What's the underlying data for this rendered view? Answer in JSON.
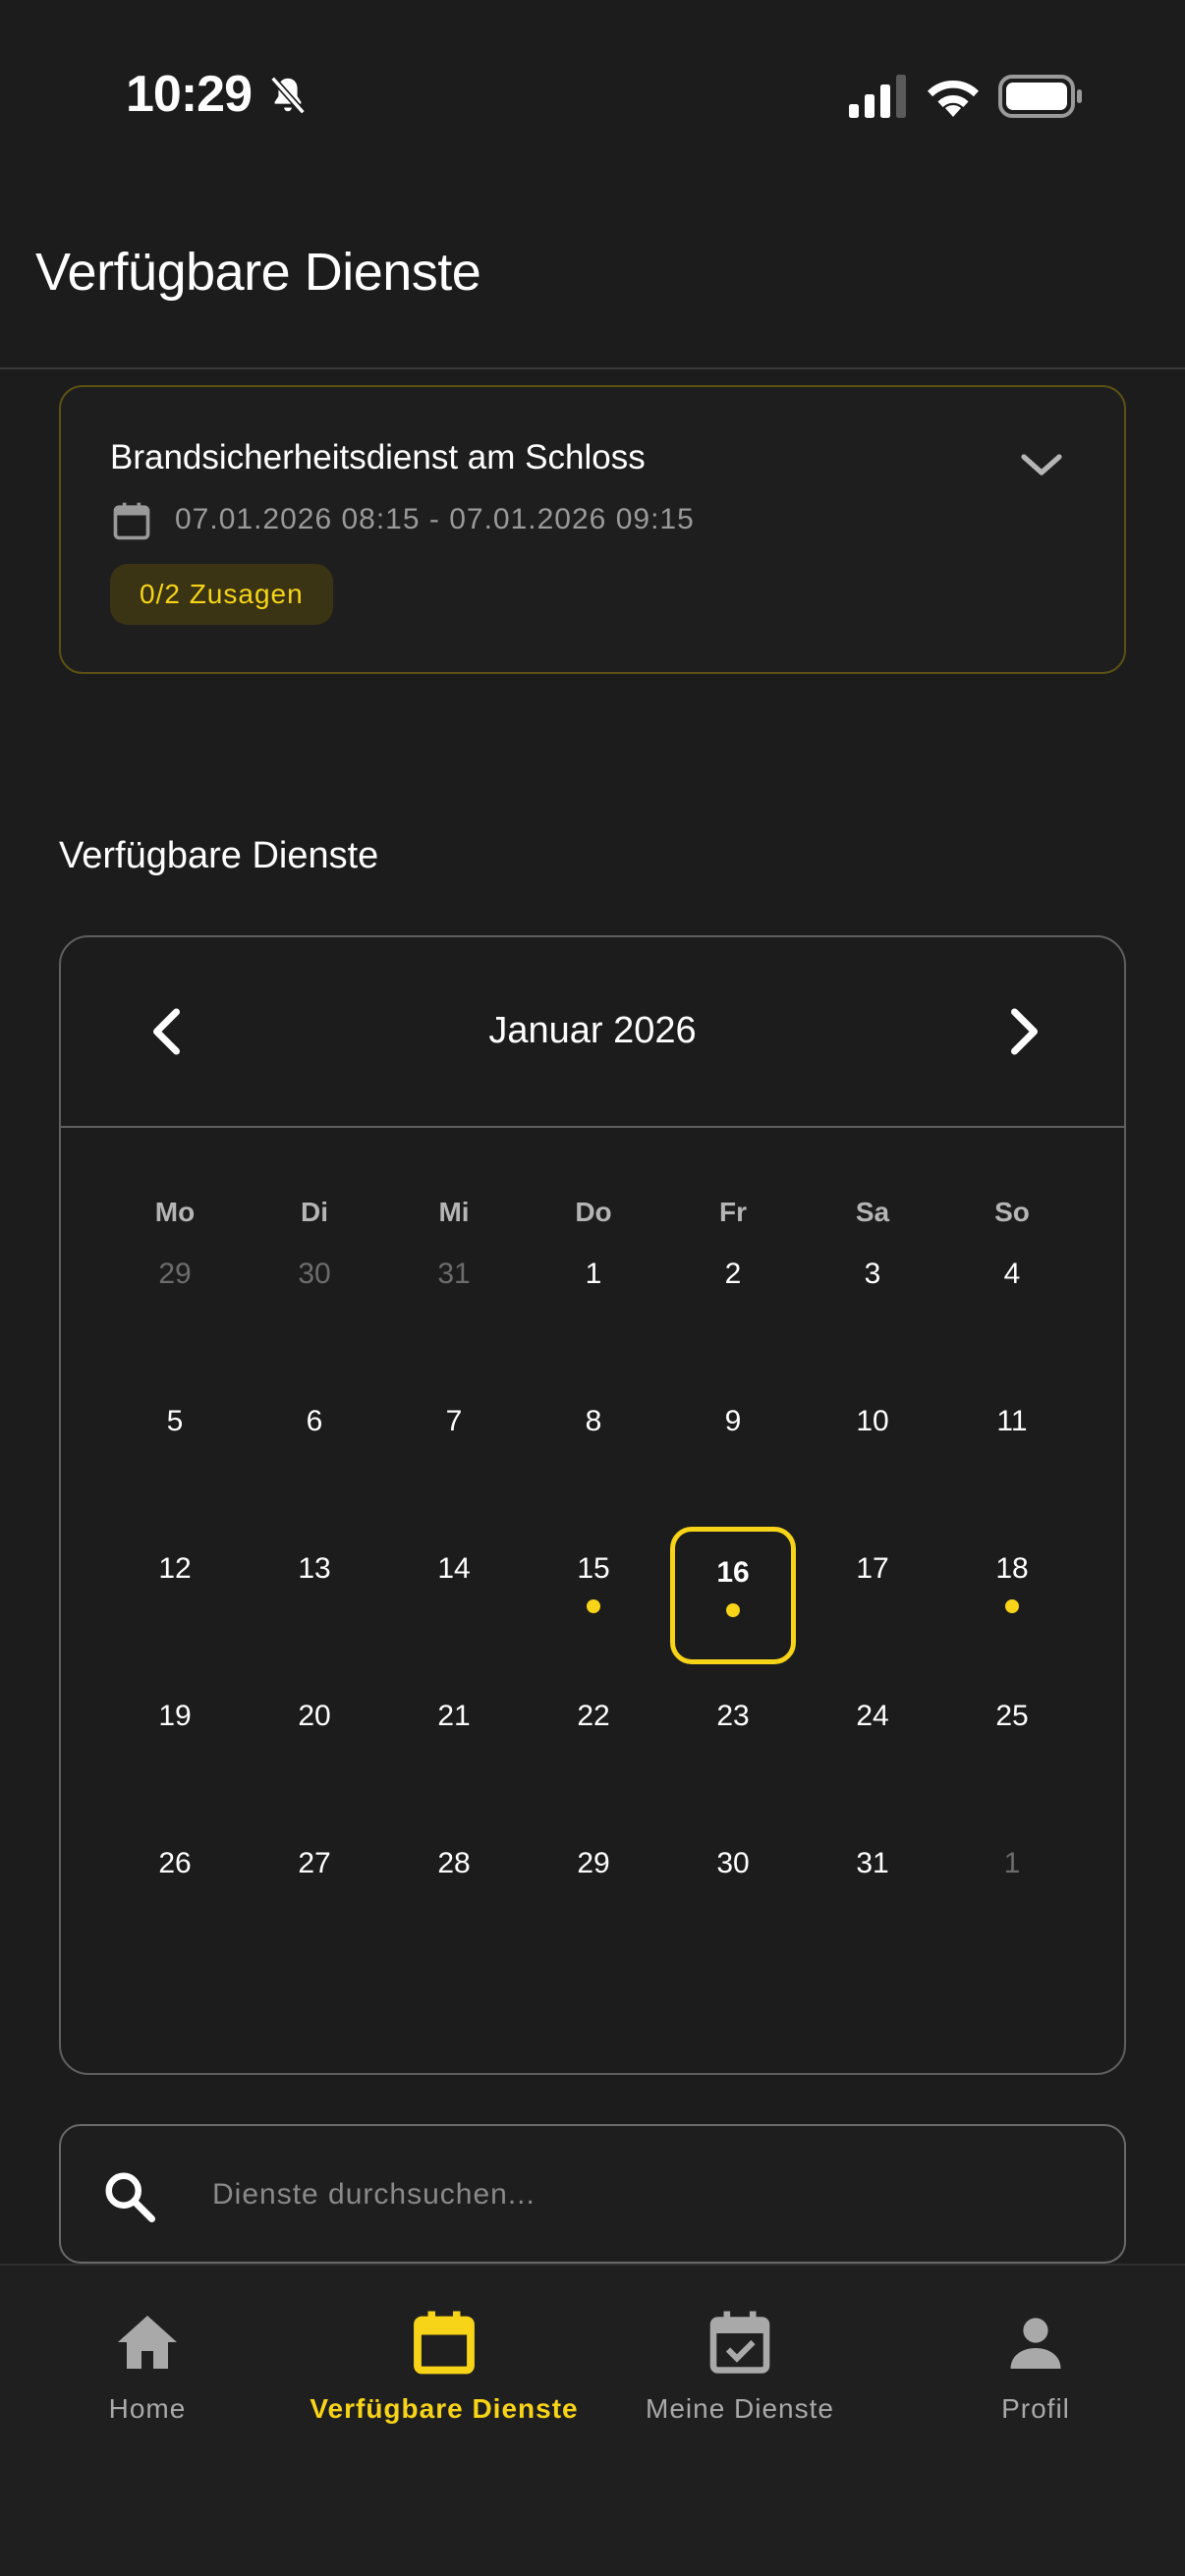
{
  "status_bar": {
    "time": "10:29",
    "icons": [
      "bell-slash-icon",
      "signal-icon",
      "wifi-icon",
      "battery-icon"
    ]
  },
  "header": {
    "title": "Verfügbare Dienste"
  },
  "shift_card": {
    "title": "Brandsicherheitsdienst am Schloss",
    "datetime": "07.01.2026 08:15 - 07.01.2026 09:15",
    "badge": "0/2 Zusagen",
    "expand_icon": "chevron-down-icon"
  },
  "section": {
    "title": "Verfügbare Dienste"
  },
  "calendar": {
    "month_label": "Januar 2026",
    "weekdays": [
      "Mo",
      "Di",
      "Mi",
      "Do",
      "Fr",
      "Sa",
      "So"
    ],
    "weeks": [
      [
        "29",
        "30",
        "31",
        "1",
        "2",
        "3",
        "4"
      ],
      [
        "5",
        "6",
        "7",
        "8",
        "9",
        "10",
        "11"
      ],
      [
        "12",
        "13",
        "14",
        "15",
        "16",
        "17",
        "18"
      ],
      [
        "19",
        "20",
        "21",
        "22",
        "23",
        "24",
        "25"
      ],
      [
        "26",
        "27",
        "28",
        "29",
        "30",
        "31",
        "1"
      ]
    ],
    "outside_month_days": [
      "29",
      "30",
      "31",
      "1"
    ],
    "days_with_events": [
      "15",
      "16",
      "18"
    ],
    "selected_day": "16"
  },
  "search": {
    "placeholder": "Dienste durchsuchen...",
    "value": ""
  },
  "bottom_nav": {
    "items": [
      {
        "label": "Home",
        "icon": "home-icon",
        "active": false
      },
      {
        "label": "Verfügbare Dienste",
        "icon": "calendar-icon",
        "active": true
      },
      {
        "label": "Meine Dienste",
        "icon": "calendar-check-icon",
        "active": false
      },
      {
        "label": "Profil",
        "icon": "person-icon",
        "active": false
      }
    ]
  },
  "colors": {
    "background": "#1c1c1c",
    "accent": "#f7d418",
    "card_border": "#5d5014",
    "badge_bg": "#3a3414",
    "muted_text": "#9a9a9a"
  }
}
